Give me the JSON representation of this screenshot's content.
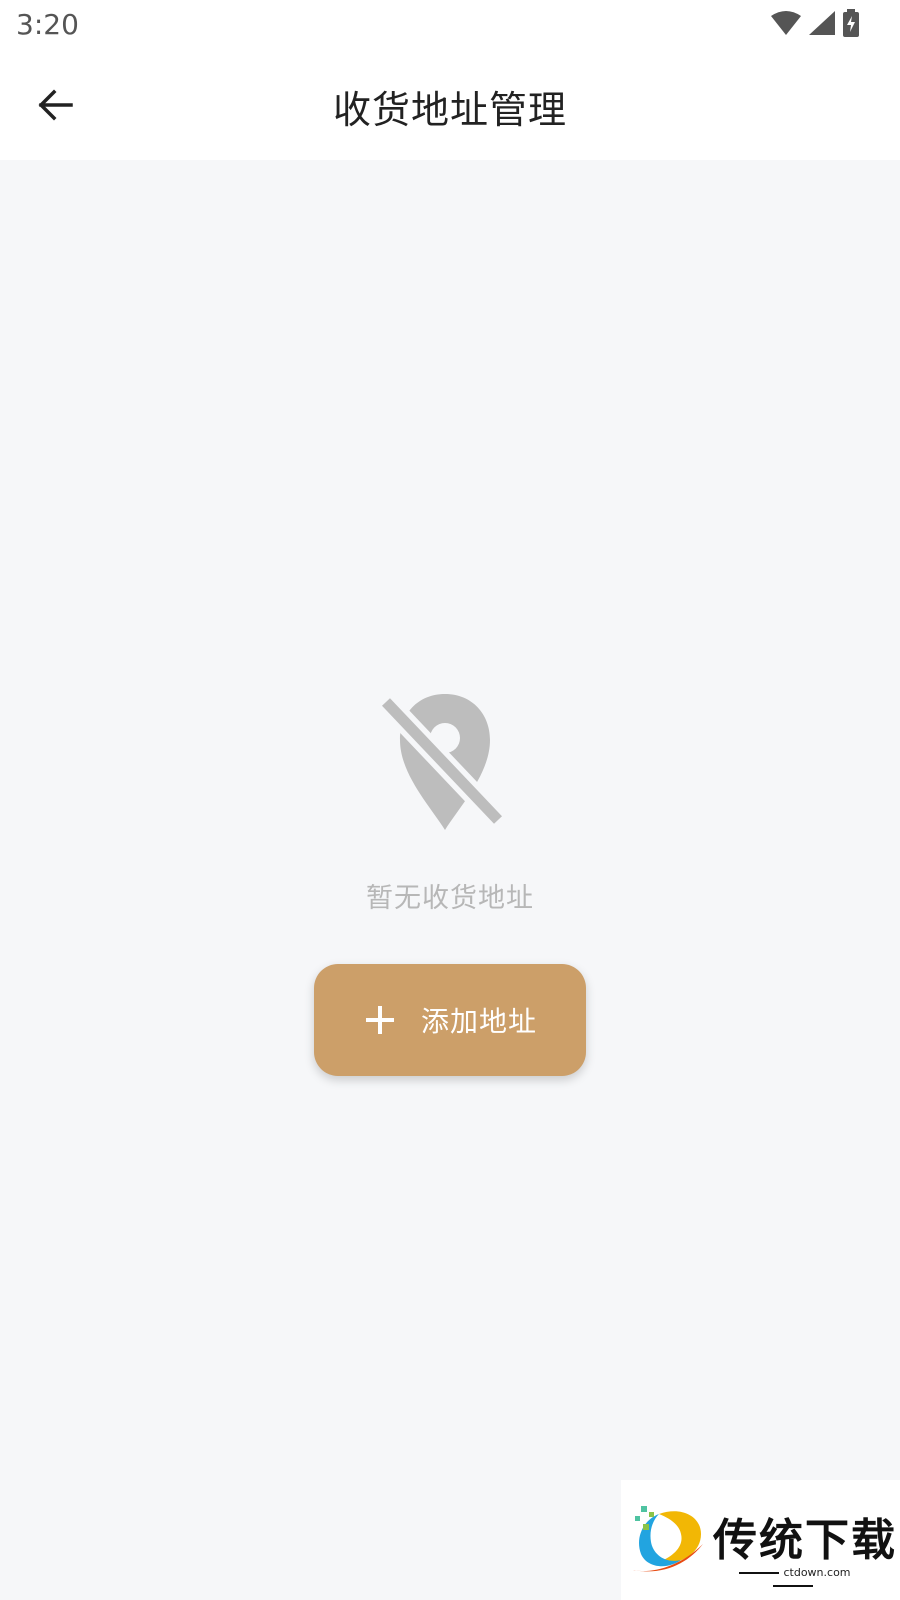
{
  "status_bar": {
    "time": "3:20",
    "icons": [
      "wifi-icon",
      "cellular-signal-icon",
      "battery-charging-icon"
    ]
  },
  "app_bar": {
    "back_icon": "arrow-left-icon",
    "title": "收货地址管理"
  },
  "empty_state": {
    "icon": "location-off-icon",
    "message": "暂无收货地址",
    "icon_color": "#bdbdbd"
  },
  "add_button": {
    "icon": "plus-icon",
    "label": "添加地址",
    "color": "#cc9f69"
  },
  "watermark": {
    "title": "传统下载",
    "url": "ctdown.com"
  }
}
